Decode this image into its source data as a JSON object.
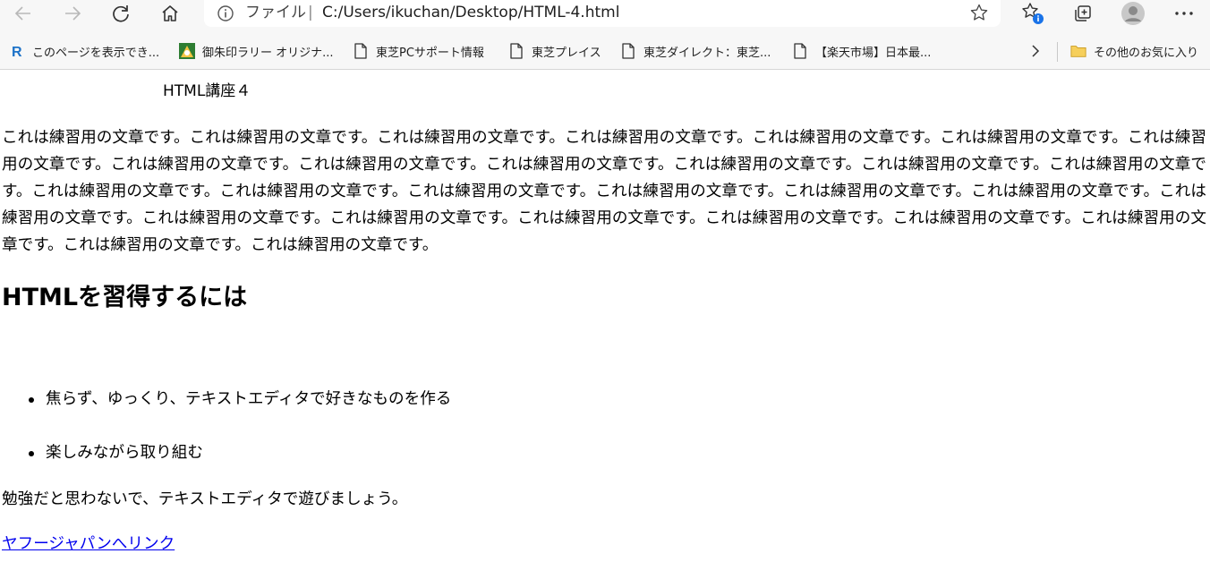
{
  "browser": {
    "address_scheme": "ファイル",
    "address_separator": "|",
    "address_url": "C:/Users/ikuchan/Desktop/HTML-4.html",
    "icons": {
      "back": "back-arrow-icon",
      "forward": "forward-arrow-icon",
      "refresh": "refresh-icon",
      "home": "home-icon",
      "info": "info-icon",
      "favorite": "star-outline-icon",
      "favorites_list": "favorites-icon",
      "collections": "collections-icon",
      "profile": "profile-avatar-icon",
      "more": "more-options-icon"
    },
    "favorites_badge_color": "#1a73e8"
  },
  "bookmarks": {
    "items": [
      {
        "label": "このページを表示でき...",
        "icon": "r-logo-icon"
      },
      {
        "label": "御朱印ラリー オリジナ...",
        "icon": "site-favicon-icon"
      },
      {
        "label": "東芝PCサポート情報",
        "icon": "page-icon"
      },
      {
        "label": "東芝プレイス",
        "icon": "page-icon"
      },
      {
        "label": "東芝ダイレクト：東芝...",
        "icon": "page-icon"
      },
      {
        "label": "【楽天市場】日本最...",
        "icon": "page-icon"
      }
    ],
    "overflow_icon": "chevron-right-icon",
    "other_favorites_label": "その他のお気に入り",
    "other_favorites_icon": "folder-icon"
  },
  "content": {
    "caption": "HTML講座４",
    "paragraph": "これは練習用の文章です。これは練習用の文章です。これは練習用の文章です。これは練習用の文章です。これは練習用の文章です。これは練習用の文章です。これは練習用の文章です。これは練習用の文章です。これは練習用の文章です。これは練習用の文章です。これは練習用の文章です。これは練習用の文章です。これは練習用の文章です。これは練習用の文章です。これは練習用の文章です。これは練習用の文章です。これは練習用の文章です。これは練習用の文章です。これは練習用の文章です。これは練習用の文章です。これは練習用の文章です。これは練習用の文章です。これは練習用の文章です。これは練習用の文章です。これは練習用の文章です。これは練習用の文章です。これは練習用の文章です。これは練習用の文章です。",
    "heading": "HTMLを習得するには",
    "list": [
      "焦らず、ゆっくり、テキストエディタで好きなものを作る",
      "楽しみながら取り組む"
    ],
    "closing": "勉強だと思わないで、テキストエディタで遊びましょう。",
    "link": "ヤフージャパンへリンク"
  },
  "colors": {
    "chrome_bg": "#f7f7f7",
    "link": "#0000ee"
  }
}
